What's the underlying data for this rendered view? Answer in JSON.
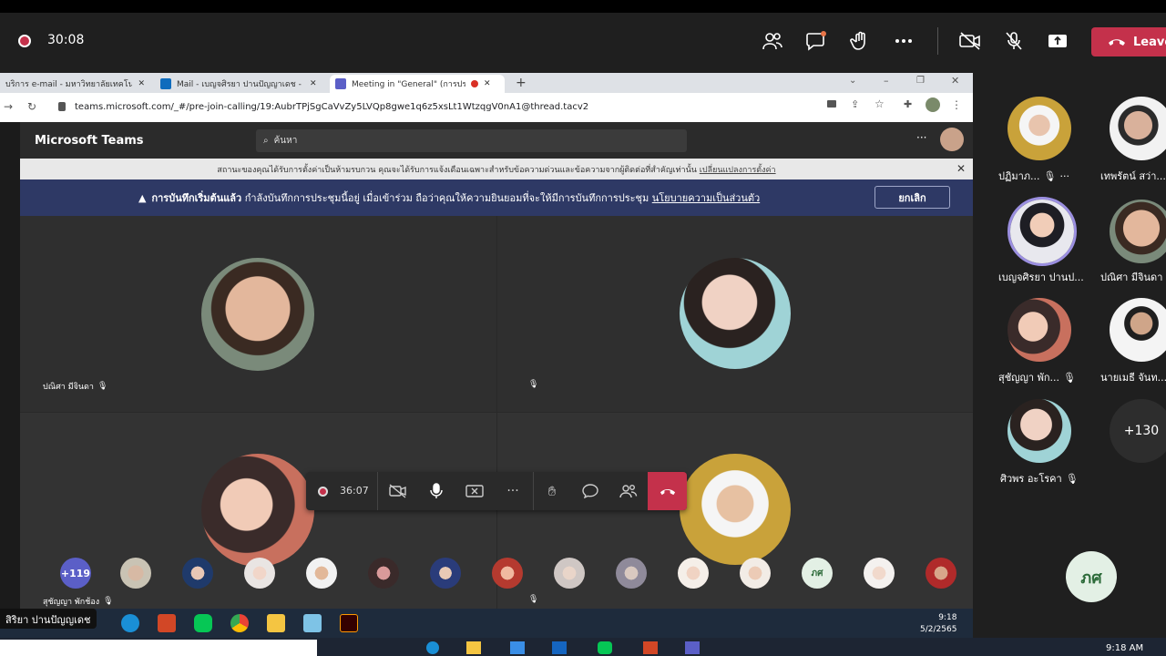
{
  "recording": {
    "time": "30:08"
  },
  "meeting_controls": {
    "leave_label": "Leave"
  },
  "browser": {
    "tabs": [
      {
        "label": "บริการ e-mail - มหาวิทยาลัยเทคโนโลยี",
        "active": false
      },
      {
        "label": "Mail - เบญจศิรยา ปานปัญญาเดช - Out",
        "active": false
      },
      {
        "label": "Meeting in \"General\" (การประ",
        "active": true
      }
    ],
    "url": "teams.microsoft.com/_#/pre-join-calling/19:AubrTPjSgCaVvZy5LVQp8gwe1q6z5xsLt1WtzqgV0nA1@thread.tacv2"
  },
  "teams": {
    "app_title": "Microsoft Teams",
    "search_placeholder": "ค้นหา",
    "status_notice": "สถานะของคุณได้รับการตั้งค่าเป็นห้ามรบกวน คุณจะได้รับการแจ้งเดือนเฉพาะสำหรับข้อความด่วนและข้อความจากผู้ติดต่อที่สำคัญเท่านั้น",
    "status_notice_link": "เปลี่ยนแปลงการตั้งค่า",
    "recording_banner_bold": "การบันทึกเริ่มต้นแล้ว",
    "recording_banner_text": "กำลังบันทึกการประชุมนี้อยู่ เมื่อเข้าร่วม ถือว่าคุณให้ความยินยอมที่จะให้มีการบันทึกการประชุม",
    "recording_banner_link": "นโยบายความเป็นส่วนตัว",
    "cancel_label": "ยกเลิก",
    "call_time": "36:07",
    "tiles": [
      {
        "name": "ปณิศา มีจินดา"
      },
      {
        "name": ""
      },
      {
        "name": "สุชัญญา พักช้อง"
      },
      {
        "name": ""
      }
    ],
    "overflow_count": "+119",
    "strip_initials": "ภศ",
    "clock_time": "9:18",
    "clock_date": "5/2/2565"
  },
  "presenter_name": "สิริยา ปานปัญญเดช",
  "gallery": {
    "participants": [
      {
        "name": "ปฏิมาภ...",
        "muted": true
      },
      {
        "name": "เทพรัตน์ สว่า..."
      },
      {
        "name": "เบญจศิรยา ปานป...",
        "speaking": true
      },
      {
        "name": "ปณิศา มีจินดา"
      },
      {
        "name": "สุชัญญา พัก...",
        "muted": true
      },
      {
        "name": "นายเมธี จันท..."
      },
      {
        "name": "ศิวพร อะโรคา",
        "muted": true
      }
    ],
    "more_count": "+130",
    "self_initials": "ภศ"
  },
  "host_clock": "9:18 AM",
  "colors": {
    "accent_red": "#c4314b",
    "banner_blue": "#2e3965",
    "speaking_ring": "#9b8fe0"
  }
}
